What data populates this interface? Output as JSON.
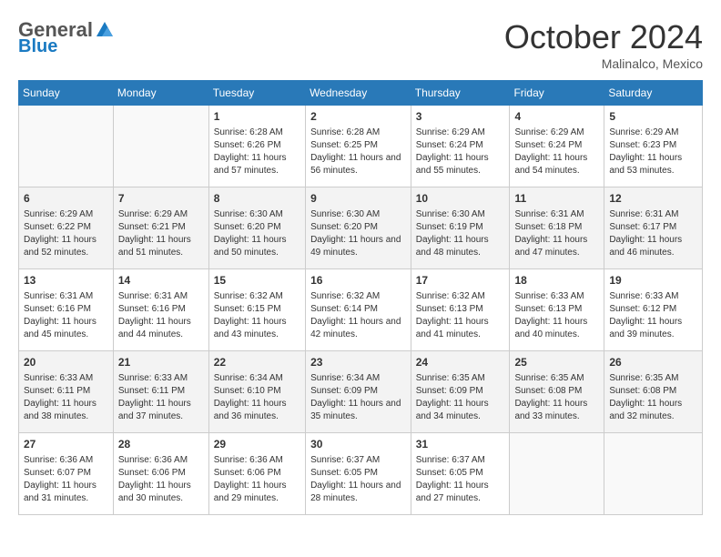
{
  "header": {
    "logo_general": "General",
    "logo_blue": "Blue",
    "month": "October 2024",
    "location": "Malinalco, Mexico"
  },
  "days_of_week": [
    "Sunday",
    "Monday",
    "Tuesday",
    "Wednesday",
    "Thursday",
    "Friday",
    "Saturday"
  ],
  "weeks": [
    [
      {
        "day": "",
        "sunrise": "",
        "sunset": "",
        "daylight": ""
      },
      {
        "day": "",
        "sunrise": "",
        "sunset": "",
        "daylight": ""
      },
      {
        "day": "1",
        "sunrise": "Sunrise: 6:28 AM",
        "sunset": "Sunset: 6:26 PM",
        "daylight": "Daylight: 11 hours and 57 minutes."
      },
      {
        "day": "2",
        "sunrise": "Sunrise: 6:28 AM",
        "sunset": "Sunset: 6:25 PM",
        "daylight": "Daylight: 11 hours and 56 minutes."
      },
      {
        "day": "3",
        "sunrise": "Sunrise: 6:29 AM",
        "sunset": "Sunset: 6:24 PM",
        "daylight": "Daylight: 11 hours and 55 minutes."
      },
      {
        "day": "4",
        "sunrise": "Sunrise: 6:29 AM",
        "sunset": "Sunset: 6:24 PM",
        "daylight": "Daylight: 11 hours and 54 minutes."
      },
      {
        "day": "5",
        "sunrise": "Sunrise: 6:29 AM",
        "sunset": "Sunset: 6:23 PM",
        "daylight": "Daylight: 11 hours and 53 minutes."
      }
    ],
    [
      {
        "day": "6",
        "sunrise": "Sunrise: 6:29 AM",
        "sunset": "Sunset: 6:22 PM",
        "daylight": "Daylight: 11 hours and 52 minutes."
      },
      {
        "day": "7",
        "sunrise": "Sunrise: 6:29 AM",
        "sunset": "Sunset: 6:21 PM",
        "daylight": "Daylight: 11 hours and 51 minutes."
      },
      {
        "day": "8",
        "sunrise": "Sunrise: 6:30 AM",
        "sunset": "Sunset: 6:20 PM",
        "daylight": "Daylight: 11 hours and 50 minutes."
      },
      {
        "day": "9",
        "sunrise": "Sunrise: 6:30 AM",
        "sunset": "Sunset: 6:20 PM",
        "daylight": "Daylight: 11 hours and 49 minutes."
      },
      {
        "day": "10",
        "sunrise": "Sunrise: 6:30 AM",
        "sunset": "Sunset: 6:19 PM",
        "daylight": "Daylight: 11 hours and 48 minutes."
      },
      {
        "day": "11",
        "sunrise": "Sunrise: 6:31 AM",
        "sunset": "Sunset: 6:18 PM",
        "daylight": "Daylight: 11 hours and 47 minutes."
      },
      {
        "day": "12",
        "sunrise": "Sunrise: 6:31 AM",
        "sunset": "Sunset: 6:17 PM",
        "daylight": "Daylight: 11 hours and 46 minutes."
      }
    ],
    [
      {
        "day": "13",
        "sunrise": "Sunrise: 6:31 AM",
        "sunset": "Sunset: 6:16 PM",
        "daylight": "Daylight: 11 hours and 45 minutes."
      },
      {
        "day": "14",
        "sunrise": "Sunrise: 6:31 AM",
        "sunset": "Sunset: 6:16 PM",
        "daylight": "Daylight: 11 hours and 44 minutes."
      },
      {
        "day": "15",
        "sunrise": "Sunrise: 6:32 AM",
        "sunset": "Sunset: 6:15 PM",
        "daylight": "Daylight: 11 hours and 43 minutes."
      },
      {
        "day": "16",
        "sunrise": "Sunrise: 6:32 AM",
        "sunset": "Sunset: 6:14 PM",
        "daylight": "Daylight: 11 hours and 42 minutes."
      },
      {
        "day": "17",
        "sunrise": "Sunrise: 6:32 AM",
        "sunset": "Sunset: 6:13 PM",
        "daylight": "Daylight: 11 hours and 41 minutes."
      },
      {
        "day": "18",
        "sunrise": "Sunrise: 6:33 AM",
        "sunset": "Sunset: 6:13 PM",
        "daylight": "Daylight: 11 hours and 40 minutes."
      },
      {
        "day": "19",
        "sunrise": "Sunrise: 6:33 AM",
        "sunset": "Sunset: 6:12 PM",
        "daylight": "Daylight: 11 hours and 39 minutes."
      }
    ],
    [
      {
        "day": "20",
        "sunrise": "Sunrise: 6:33 AM",
        "sunset": "Sunset: 6:11 PM",
        "daylight": "Daylight: 11 hours and 38 minutes."
      },
      {
        "day": "21",
        "sunrise": "Sunrise: 6:33 AM",
        "sunset": "Sunset: 6:11 PM",
        "daylight": "Daylight: 11 hours and 37 minutes."
      },
      {
        "day": "22",
        "sunrise": "Sunrise: 6:34 AM",
        "sunset": "Sunset: 6:10 PM",
        "daylight": "Daylight: 11 hours and 36 minutes."
      },
      {
        "day": "23",
        "sunrise": "Sunrise: 6:34 AM",
        "sunset": "Sunset: 6:09 PM",
        "daylight": "Daylight: 11 hours and 35 minutes."
      },
      {
        "day": "24",
        "sunrise": "Sunrise: 6:35 AM",
        "sunset": "Sunset: 6:09 PM",
        "daylight": "Daylight: 11 hours and 34 minutes."
      },
      {
        "day": "25",
        "sunrise": "Sunrise: 6:35 AM",
        "sunset": "Sunset: 6:08 PM",
        "daylight": "Daylight: 11 hours and 33 minutes."
      },
      {
        "day": "26",
        "sunrise": "Sunrise: 6:35 AM",
        "sunset": "Sunset: 6:08 PM",
        "daylight": "Daylight: 11 hours and 32 minutes."
      }
    ],
    [
      {
        "day": "27",
        "sunrise": "Sunrise: 6:36 AM",
        "sunset": "Sunset: 6:07 PM",
        "daylight": "Daylight: 11 hours and 31 minutes."
      },
      {
        "day": "28",
        "sunrise": "Sunrise: 6:36 AM",
        "sunset": "Sunset: 6:06 PM",
        "daylight": "Daylight: 11 hours and 30 minutes."
      },
      {
        "day": "29",
        "sunrise": "Sunrise: 6:36 AM",
        "sunset": "Sunset: 6:06 PM",
        "daylight": "Daylight: 11 hours and 29 minutes."
      },
      {
        "day": "30",
        "sunrise": "Sunrise: 6:37 AM",
        "sunset": "Sunset: 6:05 PM",
        "daylight": "Daylight: 11 hours and 28 minutes."
      },
      {
        "day": "31",
        "sunrise": "Sunrise: 6:37 AM",
        "sunset": "Sunset: 6:05 PM",
        "daylight": "Daylight: 11 hours and 27 minutes."
      },
      {
        "day": "",
        "sunrise": "",
        "sunset": "",
        "daylight": ""
      },
      {
        "day": "",
        "sunrise": "",
        "sunset": "",
        "daylight": ""
      }
    ]
  ]
}
